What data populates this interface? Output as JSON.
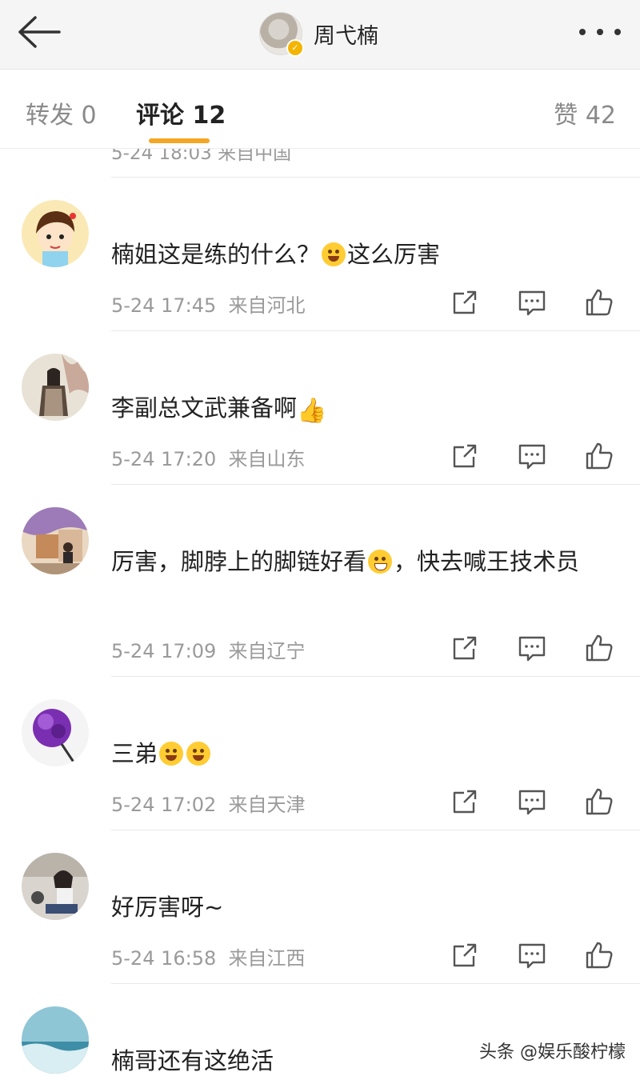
{
  "header": {
    "title": "周弋楠",
    "verified": "✓"
  },
  "tabs": {
    "repost": "转发 0",
    "comment": "评论 12",
    "like": "赞 42"
  },
  "partial": {
    "meta": "5-24 18:03  来自中国"
  },
  "comments": [
    {
      "text": "楠姐这是练的什么？",
      "text2": "这么厉害",
      "time": "5-24 17:45",
      "source": "来自河北"
    },
    {
      "text": "李副总文武兼备啊",
      "time": "5-24 17:20",
      "source": "来自山东"
    },
    {
      "text": "厉害，脚脖上的脚链好看",
      "text2": "，快去喊王技术员",
      "time": "5-24 17:09",
      "source": "来自辽宁"
    },
    {
      "text": "三弟",
      "time": "5-24 17:02",
      "source": "来自天津"
    },
    {
      "text": "好厉害呀~",
      "time": "5-24 16:58",
      "source": "来自江西"
    },
    {
      "text": "楠哥还有这绝活"
    }
  ],
  "watermark": "头条 @娱乐酸柠檬"
}
